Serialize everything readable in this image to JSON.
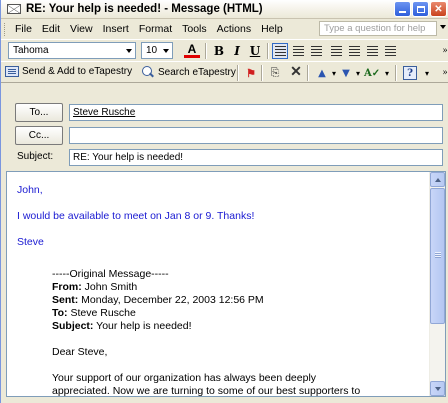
{
  "window": {
    "title": "RE: Your help is needed! - Message (HTML)"
  },
  "menubar": {
    "items": [
      "File",
      "Edit",
      "View",
      "Insert",
      "Format",
      "Tools",
      "Actions",
      "Help"
    ],
    "help_placeholder": "Type a question for help"
  },
  "format_toolbar": {
    "font": "Tahoma",
    "size": "10",
    "bold": "B",
    "italic": "I",
    "underline": "U"
  },
  "standard_toolbar": {
    "send_label": "Send & Add to eTapestry",
    "search_label": "Search eTapestry"
  },
  "header_fields": {
    "to_label": "To...",
    "to_value": "Steve Rusche",
    "cc_label": "Cc...",
    "cc_value": "",
    "subject_label": "Subject:",
    "subject_value": "RE: Your help is needed!"
  },
  "message": {
    "greeting": "John,",
    "line1": "I would be available to meet on Jan 8 or 9.  Thanks!",
    "signature": "Steve",
    "original_header": "-----Original Message-----",
    "from_label": "From:",
    "from_value": "John Smith",
    "sent_label": "Sent:",
    "sent_value": "Monday, December 22, 2003 12:56 PM",
    "to_label": "To:",
    "to_value": "Steve Rusche",
    "subject_label": "Subject:",
    "subject_value": "Your help is needed!",
    "salutation": "Dear Steve,",
    "para_line1": "Your support of our organization has always been deeply",
    "para_line2": "appreciated.  Now we are turning to some of our best supporters to"
  },
  "colors": {
    "reply_text": "#1A1AD2",
    "accent": "#316AC5"
  }
}
